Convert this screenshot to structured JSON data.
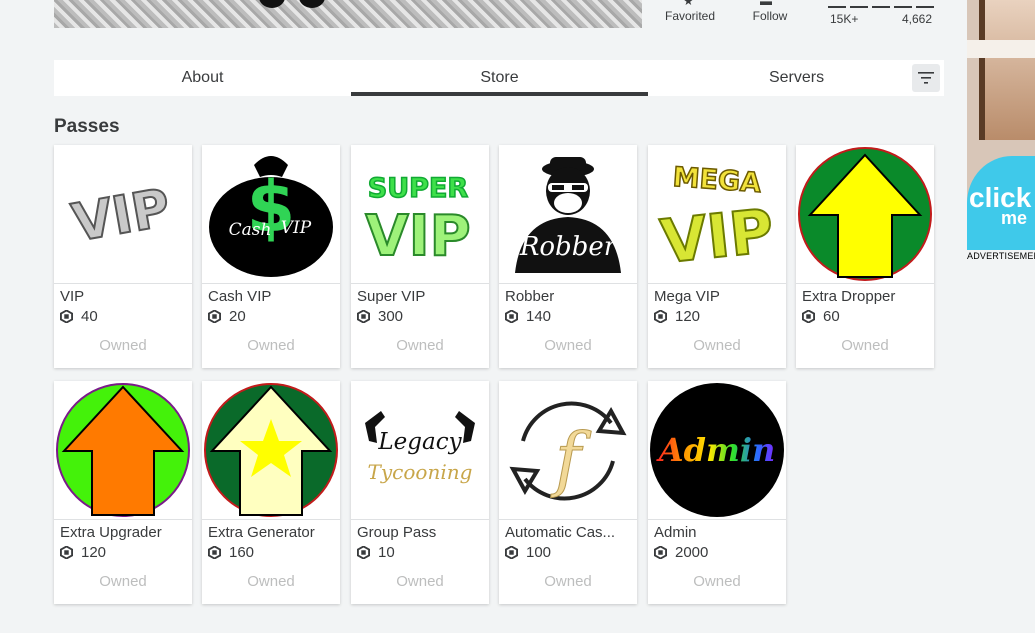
{
  "header": {
    "stats": [
      {
        "label": "Favorited",
        "icon": "star-icon"
      },
      {
        "label": "Follow",
        "icon": "follow-icon"
      }
    ],
    "votes": {
      "up": "15K+",
      "down": "4,662"
    }
  },
  "tabs": [
    {
      "label": "About",
      "active": false
    },
    {
      "label": "Store",
      "active": true
    },
    {
      "label": "Servers",
      "active": false
    }
  ],
  "section_title": "Passes",
  "passes": [
    {
      "name": "VIP",
      "price": "40",
      "status": "Owned",
      "icon": "vip-pass-icon"
    },
    {
      "name": "Cash VIP",
      "price": "20",
      "status": "Owned",
      "icon": "cash-vip-pass-icon"
    },
    {
      "name": "Super VIP",
      "price": "300",
      "status": "Owned",
      "icon": "super-vip-pass-icon"
    },
    {
      "name": "Robber",
      "price": "140",
      "status": "Owned",
      "icon": "robber-pass-icon"
    },
    {
      "name": "Mega VIP",
      "price": "120",
      "status": "Owned",
      "icon": "mega-vip-pass-icon"
    },
    {
      "name": "Extra Dropper",
      "price": "60",
      "status": "Owned",
      "icon": "extra-dropper-pass-icon"
    },
    {
      "name": "Extra Upgrader",
      "price": "120",
      "status": "Owned",
      "icon": "extra-upgrader-pass-icon"
    },
    {
      "name": "Extra Generator",
      "price": "160",
      "status": "Owned",
      "icon": "extra-generator-pass-icon"
    },
    {
      "name": "Group Pass",
      "price": "10",
      "status": "Owned",
      "icon": "group-pass-icon"
    },
    {
      "name": "Automatic Cas...",
      "price": "100",
      "status": "Owned",
      "icon": "automatic-cash-pass-icon"
    },
    {
      "name": "Admin",
      "price": "2000",
      "status": "Owned",
      "icon": "admin-pass-icon"
    }
  ],
  "thumb_text": {
    "vip": "VIP",
    "cash": "Cash",
    "cash_vip": "VIP",
    "dollar": "$",
    "super": "SUPER",
    "super_vip": "VIP",
    "robber": "Robber",
    "mega": "MEGA",
    "mega_vip": "VIP",
    "legacy": "Legacy",
    "tycooning": "Tycooning",
    "f": "f",
    "admin": "Admin"
  },
  "ad": {
    "label": "ADVERTISEMENT",
    "text": "click",
    "text2": "me"
  },
  "colors": {
    "accent": "#393b3d",
    "owned": "#bdbebe",
    "green": "#0a8a2a",
    "yellow": "#ffff00",
    "orange": "#ff7a00",
    "lime": "#44f20a"
  }
}
